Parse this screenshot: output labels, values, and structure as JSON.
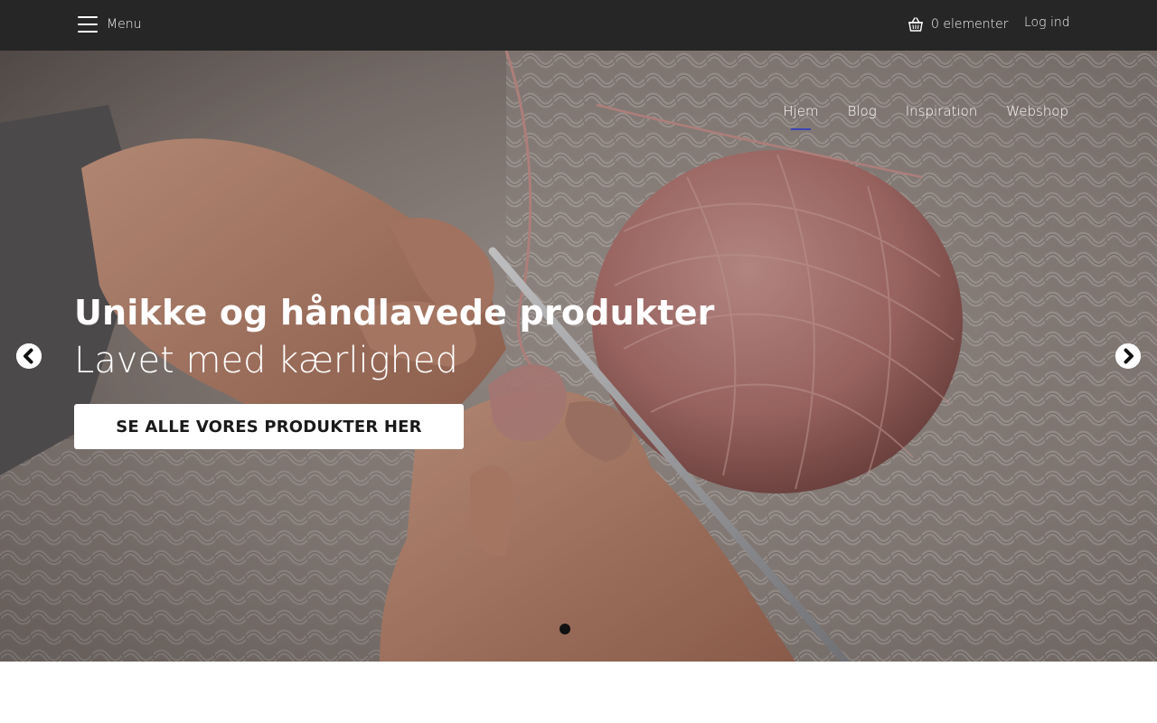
{
  "topbar": {
    "menu_label": "Menu",
    "cart_label": "0 elementer",
    "login_label": "Log ind"
  },
  "nav": {
    "items": [
      {
        "label": "Hjem",
        "active": true
      },
      {
        "label": "Blog"
      },
      {
        "label": "Inspiration"
      },
      {
        "label": "Webshop"
      }
    ]
  },
  "hero": {
    "title": "Unikke og håndlavede produkter",
    "subtitle": "Lavet med kærlighed",
    "cta_label": "SE ALLE VORES PRODUKTER HER",
    "slide_count": 1,
    "active_slide": 1
  },
  "colors": {
    "topbar_bg": "#262626",
    "accent": "#3a44b8",
    "yarn": "#c98a86"
  },
  "icons": {
    "menu": "hamburger-icon",
    "cart": "basket-icon",
    "prev": "chevron-left-circle-icon",
    "next": "chevron-right-circle-icon"
  }
}
